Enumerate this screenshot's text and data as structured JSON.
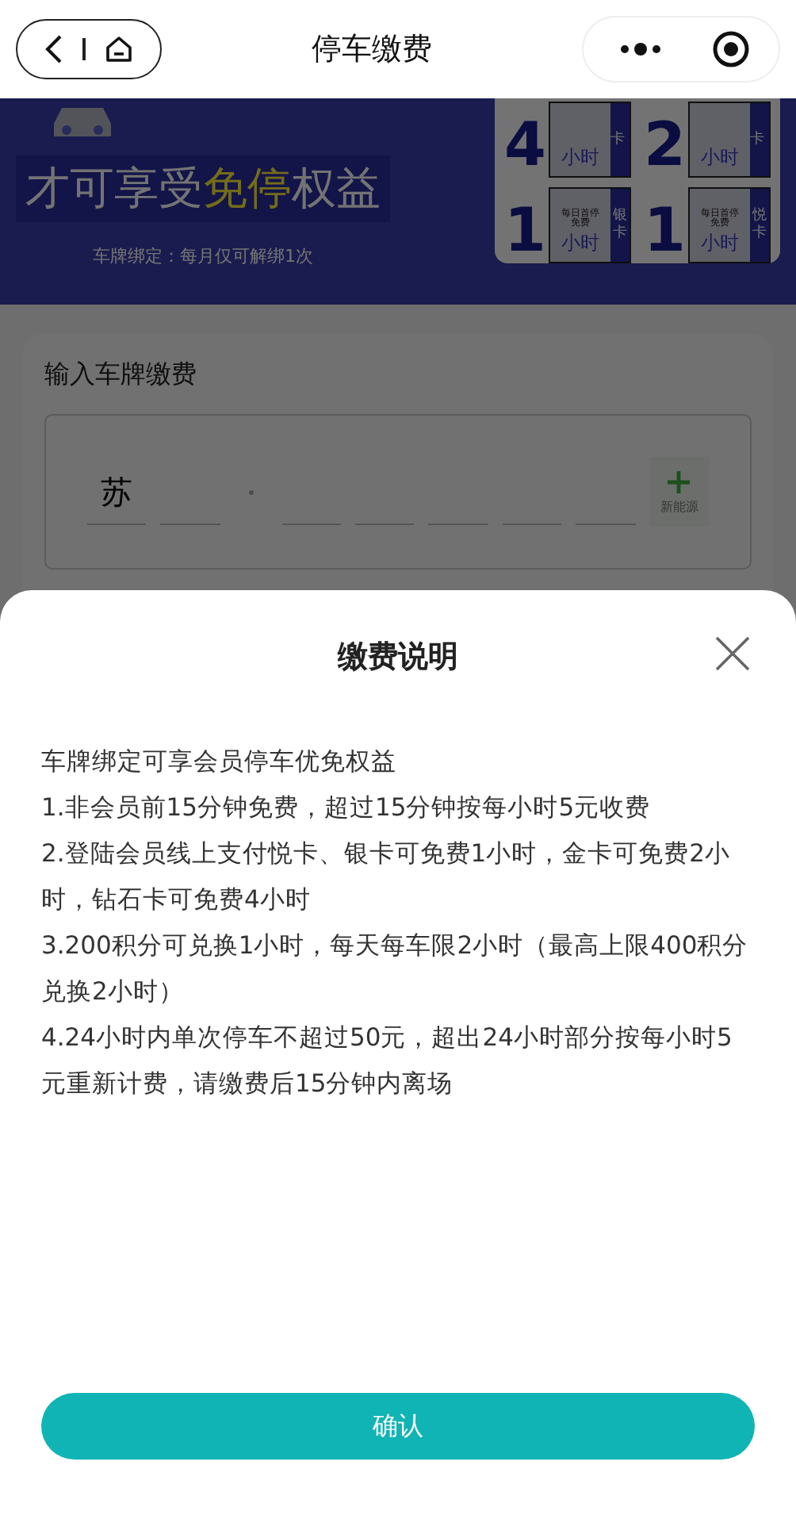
{
  "nav": {
    "title": "停车缴费"
  },
  "banner": {
    "headline_parts": [
      {
        "text": "才可享受",
        "highlight": false
      },
      {
        "text": "免停",
        "highlight": true
      },
      {
        "text": "权益",
        "highlight": false
      }
    ],
    "note": "车牌绑定：每月仅可解绑1次",
    "cards": [
      {
        "number": "4",
        "unit": "小时",
        "side": "卡"
      },
      {
        "number": "2",
        "unit": "小时",
        "side": "卡"
      },
      {
        "number": "1",
        "caption": "每日首停免费",
        "unit": "小时",
        "side": "银卡"
      },
      {
        "number": "1",
        "caption": "每日首停免费",
        "unit": "小时",
        "side": "悦卡"
      }
    ]
  },
  "plate_section": {
    "label": "输入车牌缴费",
    "entered": [
      "苏"
    ],
    "new_energy": {
      "label": "新能源"
    }
  },
  "dialog": {
    "title": "缴费说明",
    "lines": [
      "车牌绑定可享会员停车优免权益",
      "1.非会员前15分钟免费，超过15分钟按每小时5元收费",
      "2.登陆会员线上支付悦卡、银卡可免费1小时，金卡可免费2小时，钻石卡可免费4小时",
      "3.200积分可兑换1小时，每天每车限2小时（最高上限400积分兑换2小时）",
      "4.24小时内单次停车不超过50元，超出24小时部分按每小时5元重新计费，请缴费后15分钟内离场"
    ],
    "confirm": "确认"
  }
}
